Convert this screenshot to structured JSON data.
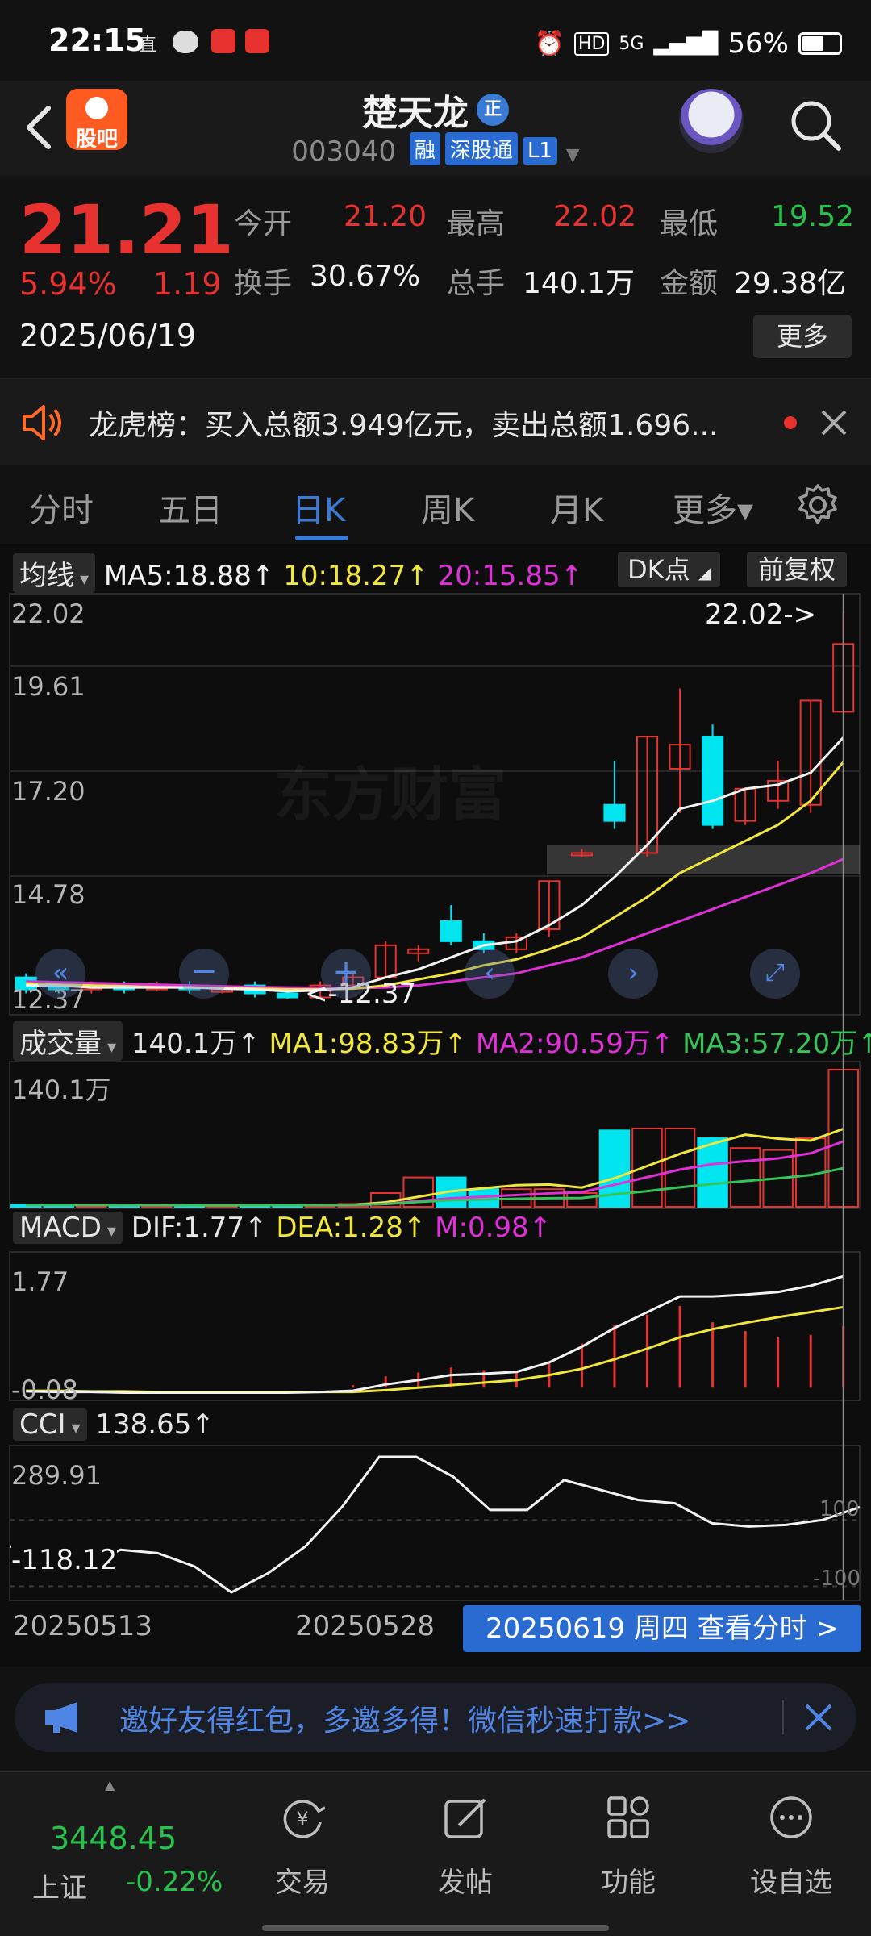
{
  "status_bar": {
    "time": "22:15",
    "icons_left": [
      "直",
      "wechat-icon",
      "app-icon",
      "app-icon"
    ],
    "signal": "5G",
    "battery": "56%",
    "battery_level": 0.56
  },
  "header": {
    "app_logo_label": "股吧",
    "stock_name": "楚天龙",
    "name_badge": "正",
    "stock_code": "003040",
    "tags": [
      "融",
      "深股通",
      "L1"
    ]
  },
  "quote": {
    "price": "21.21",
    "change_pct": "5.94%",
    "change": "1.19",
    "date": "2025/06/19",
    "open_label": "今开",
    "open": "21.20",
    "high_label": "最高",
    "high": "22.02",
    "low_label": "最低",
    "low": "19.52",
    "turnover_label": "换手",
    "turnover": "30.67%",
    "volume_label": "总手",
    "volume": "140.1万",
    "amount_label": "金额",
    "amount": "29.38亿",
    "more_label": "更多"
  },
  "notice": {
    "text": "龙虎榜：买入总额3.949亿元，卖出总额1.696..."
  },
  "tabs": [
    {
      "label": "分时"
    },
    {
      "label": "五日"
    },
    {
      "label": "日K"
    },
    {
      "label": "周K"
    },
    {
      "label": "月K"
    },
    {
      "label": "更多▾"
    }
  ],
  "active_tab": "日K",
  "chart": {
    "ma_selector": "均线",
    "ma5": "MA5:18.88↑",
    "ma10": "10:18.27↑",
    "ma20": "20:15.85↑",
    "dk_label": "DK点",
    "adjust_label": "前复权",
    "watermark": "东方财富",
    "price_axis": [
      "22.02",
      "19.61",
      "17.20",
      "14.78",
      "12.37"
    ],
    "high_marker": "22.02->",
    "low_marker": "<-12.37",
    "vol_selector": "成交量",
    "vol_now": "140.1万↑",
    "vol_ma1": "MA1:98.83万↑",
    "vol_ma2": "MA2:90.59万↑",
    "vol_ma3": "MA3:57.20万↑",
    "vol_axis": "140.1万",
    "macd_selector": "MACD",
    "dif": "DIF:1.77↑",
    "dea": "DEA:1.28↑",
    "macd_m": "M:0.98↑",
    "macd_axis_top": "1.77",
    "macd_axis_bottom": "-0.08",
    "cci_selector": "CCI",
    "cci_val": "138.65↑",
    "cci_axis_top": "289.91",
    "cci_axis_bottom": "-118.12",
    "cci_ref_hi": "100",
    "cci_ref_lo": "-100",
    "date_start": "20250513",
    "date_mid": "20250528",
    "date_bar": "20250619 周四 查看分时 >"
  },
  "chart_data": {
    "type": "candlestick",
    "price_range": [
      12.37,
      22.02
    ],
    "candles": [
      {
        "o": 12.9,
        "c": 12.6,
        "h": 13.0,
        "l": 12.5
      },
      {
        "o": 12.7,
        "c": 12.6,
        "h": 12.8,
        "l": 12.5
      },
      {
        "o": 12.6,
        "c": 12.7,
        "h": 12.8,
        "l": 12.5
      },
      {
        "o": 12.7,
        "c": 12.6,
        "h": 12.8,
        "l": 12.5
      },
      {
        "o": 12.6,
        "c": 12.7,
        "h": 12.8,
        "l": 12.55
      },
      {
        "o": 12.7,
        "c": 12.6,
        "h": 12.8,
        "l": 12.5
      },
      {
        "o": 12.6,
        "c": 12.6,
        "h": 12.7,
        "l": 12.5
      },
      {
        "o": 12.7,
        "c": 12.5,
        "h": 12.8,
        "l": 12.4
      },
      {
        "o": 12.5,
        "c": 12.4,
        "h": 12.6,
        "l": 12.37
      },
      {
        "o": 12.4,
        "c": 12.7,
        "h": 12.8,
        "l": 12.37
      },
      {
        "o": 12.7,
        "c": 12.9,
        "h": 13.0,
        "l": 12.6
      },
      {
        "o": 12.9,
        "c": 13.7,
        "h": 13.8,
        "l": 12.9
      },
      {
        "o": 13.5,
        "c": 13.6,
        "h": 13.7,
        "l": 13.3
      },
      {
        "o": 14.3,
        "c": 13.8,
        "h": 14.7,
        "l": 13.7
      },
      {
        "o": 13.8,
        "c": 13.6,
        "h": 14.0,
        "l": 13.5
      },
      {
        "o": 13.6,
        "c": 13.9,
        "h": 14.0,
        "l": 13.5
      },
      {
        "o": 14.1,
        "c": 15.3,
        "h": 15.3,
        "l": 13.9
      },
      {
        "o": 16.0,
        "c": 16.0,
        "h": 16.1,
        "l": 15.9
      },
      {
        "o": 17.2,
        "c": 16.8,
        "h": 18.3,
        "l": 16.6
      },
      {
        "o": 16.0,
        "c": 18.9,
        "h": 18.9,
        "l": 15.9
      },
      {
        "o": 18.1,
        "c": 18.7,
        "h": 20.1,
        "l": 17.0
      },
      {
        "o": 18.9,
        "c": 16.7,
        "h": 19.2,
        "l": 16.6
      },
      {
        "o": 16.8,
        "c": 17.6,
        "h": 17.6,
        "l": 16.7
      },
      {
        "o": 17.3,
        "c": 17.8,
        "h": 18.3,
        "l": 17.1
      },
      {
        "o": 17.2,
        "c": 19.8,
        "h": 19.8,
        "l": 17.0
      },
      {
        "o": 19.52,
        "c": 21.21,
        "h": 22.02,
        "l": 19.52
      }
    ],
    "ma5": [
      12.7,
      12.7,
      12.65,
      12.65,
      12.65,
      12.65,
      12.62,
      12.6,
      12.55,
      12.58,
      12.65,
      12.9,
      13.1,
      13.4,
      13.7,
      13.8,
      14.2,
      14.7,
      15.4,
      16.2,
      17.1,
      17.3,
      17.6,
      17.7,
      18.0,
      18.88
    ],
    "ma10": [
      12.75,
      12.72,
      12.7,
      12.68,
      12.66,
      12.65,
      12.63,
      12.62,
      12.6,
      12.6,
      12.62,
      12.7,
      12.85,
      13.0,
      13.2,
      13.35,
      13.6,
      13.9,
      14.4,
      14.9,
      15.5,
      15.9,
      16.3,
      16.7,
      17.3,
      18.27
    ],
    "ma20": [
      12.8,
      12.78,
      12.76,
      12.74,
      12.72,
      12.7,
      12.68,
      12.66,
      12.65,
      12.64,
      12.63,
      12.65,
      12.7,
      12.8,
      12.9,
      13.0,
      13.2,
      13.4,
      13.7,
      14.0,
      14.3,
      14.6,
      14.9,
      15.2,
      15.5,
      15.85
    ],
    "volume_max": 140.1,
    "volume": [
      2,
      2,
      1.5,
      1.5,
      1.5,
      1.5,
      1.5,
      1.5,
      2,
      2,
      3,
      14,
      30,
      30,
      18,
      18,
      18,
      14,
      78,
      80,
      80,
      70,
      60,
      58,
      70,
      140.1
    ],
    "macd_dif": [
      -0.06,
      -0.07,
      -0.07,
      -0.08,
      -0.08,
      -0.08,
      -0.08,
      -0.08,
      -0.08,
      -0.07,
      -0.05,
      0.05,
      0.12,
      0.2,
      0.22,
      0.25,
      0.4,
      0.65,
      0.95,
      1.2,
      1.45,
      1.45,
      1.48,
      1.52,
      1.62,
      1.77
    ],
    "macd_dea": [
      -0.05,
      -0.05,
      -0.06,
      -0.06,
      -0.07,
      -0.07,
      -0.07,
      -0.07,
      -0.07,
      -0.07,
      -0.07,
      -0.04,
      0.0,
      0.04,
      0.08,
      0.12,
      0.2,
      0.3,
      0.45,
      0.62,
      0.8,
      0.93,
      1.03,
      1.12,
      1.2,
      1.28
    ],
    "macd_m": [
      0,
      0,
      0,
      0,
      0,
      0,
      0,
      0,
      0,
      0,
      0.04,
      0.18,
      0.24,
      0.32,
      0.28,
      0.26,
      0.4,
      0.7,
      1.0,
      1.16,
      1.3,
      1.04,
      0.9,
      0.8,
      0.84,
      0.98
    ],
    "cci_range": [
      -118.12,
      289.91
    ],
    "cci": [
      20,
      10,
      -40,
      10,
      0,
      -40,
      -118.12,
      -60,
      20,
      140,
      289.91,
      289.91,
      230,
      130,
      130,
      220,
      190,
      160,
      150,
      90,
      80,
      85,
      100,
      138.65
    ]
  },
  "promo": {
    "text": "邀好友得红包，多邀多得！微信秒速打款>>"
  },
  "bottom_nav": {
    "index_value": "3448.45",
    "index_name": "上证",
    "index_change": "-0.22%",
    "items": [
      {
        "label": "交易",
        "icon": "trade-icon"
      },
      {
        "label": "发帖",
        "icon": "edit-icon"
      },
      {
        "label": "功能",
        "icon": "grid-icon"
      },
      {
        "label": "设自选",
        "icon": "more-icon"
      }
    ]
  },
  "colors": {
    "up": "#e8322f",
    "down": "#00e5f0",
    "ma5": "#f2f2f2",
    "ma10": "#f0e63c",
    "ma20": "#e030d8",
    "accent": "#3a7bd5"
  }
}
